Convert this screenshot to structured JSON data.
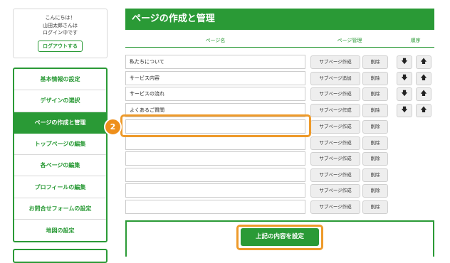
{
  "user": {
    "greeting": "こんにちは！",
    "name_line": "山田太郎さんは",
    "status_line": "ログイン中です",
    "logout_label": "ログアウトする"
  },
  "sidebar": {
    "items": [
      {
        "label": "基本情報の設定"
      },
      {
        "label": "デザインの選択"
      },
      {
        "label": "ページの作成と管理"
      },
      {
        "label": "トップページの編集"
      },
      {
        "label": "各ページの編集"
      },
      {
        "label": "プロフィールの編集"
      },
      {
        "label": "お問合せフォームの設定"
      },
      {
        "label": "地図の設定"
      }
    ],
    "active_index": 2
  },
  "callout": {
    "number": "2"
  },
  "header": {
    "title": "ページの作成と管理"
  },
  "table": {
    "columns": {
      "page_name": "ページ名",
      "page_manage": "ページ管理",
      "order": "順序"
    },
    "rows": [
      {
        "name": "私たちについて",
        "sub_label": "サブページ作成",
        "delete_label": "削除",
        "order": true
      },
      {
        "name": "サービス内容",
        "sub_label": "サブページ追加",
        "delete_label": "削除",
        "order": true
      },
      {
        "name": "サービスの流れ",
        "sub_label": "サブページ作成",
        "delete_label": "削除",
        "order": true
      },
      {
        "name": "よくあるご質問",
        "sub_label": "サブページ作成",
        "delete_label": "削除",
        "order": true
      },
      {
        "name": "",
        "sub_label": "サブページ作成",
        "delete_label": "削除",
        "order": false
      },
      {
        "name": "",
        "sub_label": "サブページ作成",
        "delete_label": "削除",
        "order": false
      },
      {
        "name": "",
        "sub_label": "サブページ作成",
        "delete_label": "削除",
        "order": false
      },
      {
        "name": "",
        "sub_label": "サブページ作成",
        "delete_label": "削除",
        "order": false
      },
      {
        "name": "",
        "sub_label": "サブページ作成",
        "delete_label": "削除",
        "order": false
      },
      {
        "name": "",
        "sub_label": "サブページ作成",
        "delete_label": "削除",
        "order": false
      }
    ],
    "order_icons": {
      "down": "arrow-down-icon",
      "up": "arrow-up-icon"
    }
  },
  "submit": {
    "label": "上記の内容を設定"
  },
  "colors": {
    "accent": "#2a9a36",
    "highlight": "#ee9a2a"
  }
}
